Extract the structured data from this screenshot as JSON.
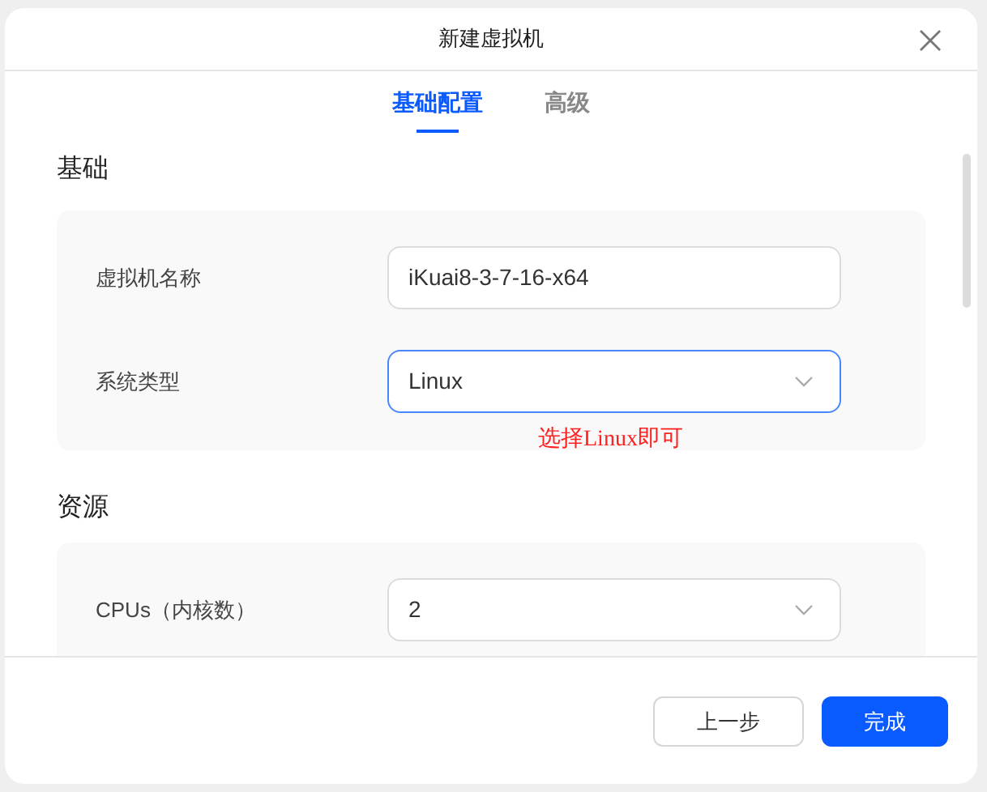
{
  "window": {
    "title": "新建虚拟机"
  },
  "tabs": [
    {
      "label": "基础配置",
      "selected": true
    },
    {
      "label": "高级",
      "selected": false
    }
  ],
  "sections": [
    {
      "title": "基础",
      "fields": [
        {
          "kind": "input",
          "label": "虚拟机名称",
          "value": "iKuai8-3-7-16-x64",
          "focused": false
        },
        {
          "kind": "select",
          "label": "系统类型",
          "value": "Linux",
          "focused": true
        }
      ],
      "annotation": "选择Linux即可"
    },
    {
      "title": "资源",
      "fields": [
        {
          "kind": "select",
          "label": "CPUs（内核数）",
          "value": "2",
          "focused": false
        }
      ]
    }
  ],
  "buttons": [
    {
      "label": "上一步",
      "kind": "secondary"
    },
    {
      "label": "完成",
      "kind": "primary"
    }
  ]
}
